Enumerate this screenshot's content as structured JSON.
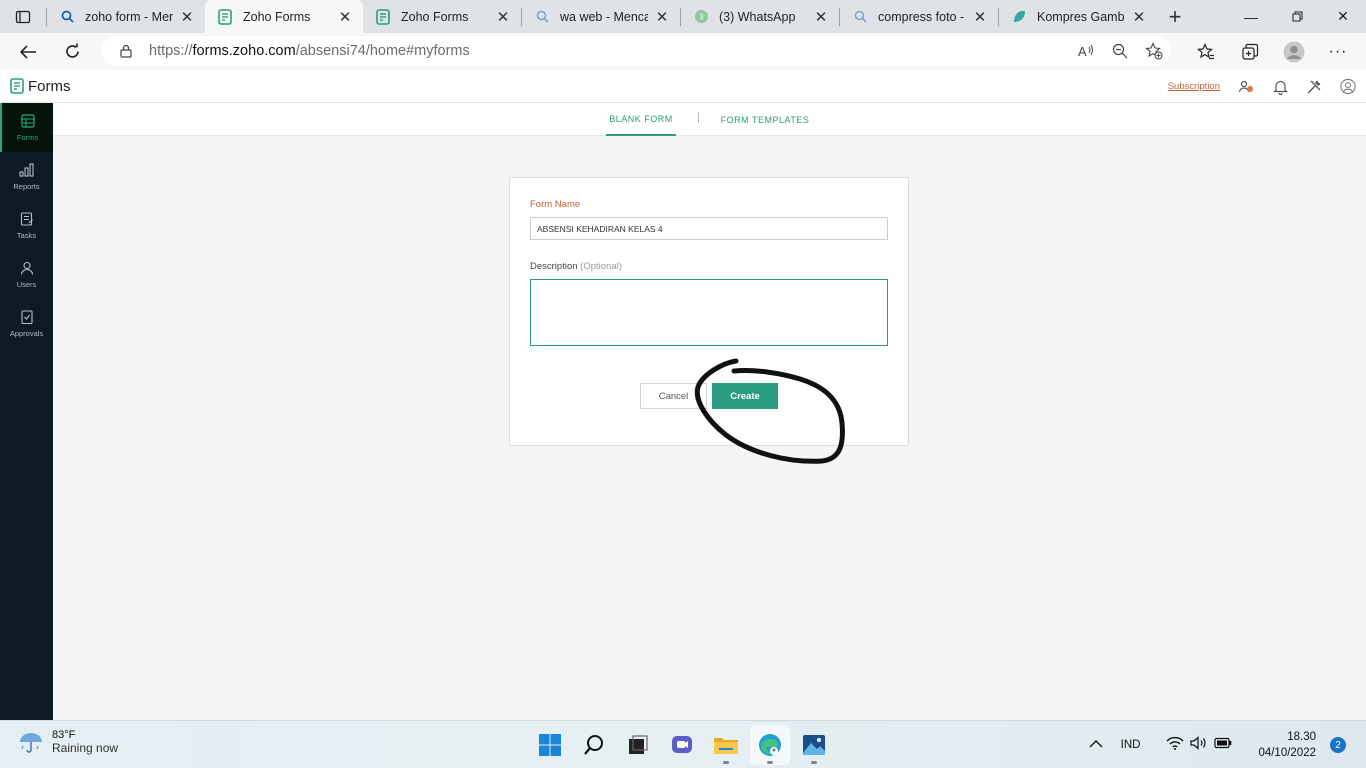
{
  "browser": {
    "tabs": [
      {
        "title": "zoho form - Mencari",
        "icon": "search-icon"
      },
      {
        "title": "Zoho Forms",
        "icon": "zoho-forms-icon",
        "active": true
      },
      {
        "title": "Zoho Forms",
        "icon": "zoho-forms-icon"
      },
      {
        "title": "wa web - Mencari",
        "icon": "search-icon"
      },
      {
        "title": "(3) WhatsApp",
        "icon": "whatsapp-icon"
      },
      {
        "title": "compress foto - Mencari",
        "icon": "search-icon"
      },
      {
        "title": "Kompres Gambar",
        "icon": "leaf-icon"
      }
    ],
    "url_scheme": "https://",
    "url_host": "forms.zoho.com",
    "url_path": "/absensi74/home#myforms"
  },
  "header": {
    "app_name": "Forms",
    "subscription": "Subscription"
  },
  "sidebar": {
    "items": [
      {
        "label": "Forms",
        "icon": "forms-icon",
        "active": true
      },
      {
        "label": "Reports",
        "icon": "reports-icon"
      },
      {
        "label": "Tasks",
        "icon": "tasks-icon"
      },
      {
        "label": "Users",
        "icon": "users-icon"
      },
      {
        "label": "Approvals",
        "icon": "approvals-icon"
      }
    ]
  },
  "form_tabs": [
    {
      "label": "BLANK FORM",
      "active": true
    },
    {
      "label": "FORM TEMPLATES"
    }
  ],
  "form": {
    "name_label": "Form Name",
    "name_value": "ABSENSI KEHADIRAN KELAS 4",
    "description_label": "Description",
    "description_optional": "(Optional)",
    "description_value": "",
    "cancel_label": "Cancel",
    "create_label": "Create"
  },
  "taskbar": {
    "temperature": "83°F",
    "weather": "Raining now",
    "language": "IND",
    "time": "18.30",
    "date": "04/10/2022",
    "notifications": "2"
  },
  "colors": {
    "accent": "#2a9d7e",
    "sidebar_bg": "#0d1a23",
    "label_orange": "#c05a32"
  }
}
